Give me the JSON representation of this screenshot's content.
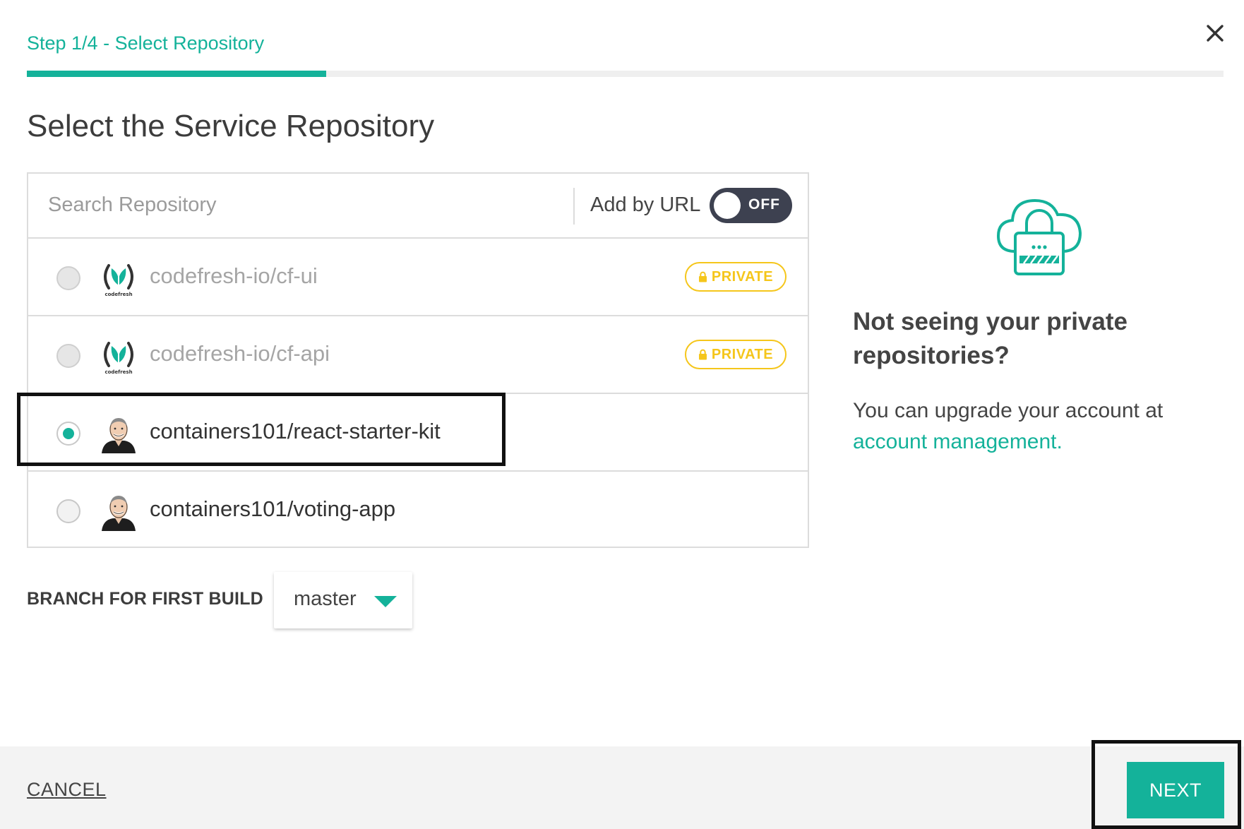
{
  "header": {
    "step_title": "Step 1/4 - Select Repository",
    "progress_fraction": 0.25,
    "close_icon": "close-icon"
  },
  "main": {
    "heading": "Select the Service Repository"
  },
  "search": {
    "placeholder": "Search Repository",
    "value": "",
    "add_by_url_label": "Add by URL",
    "toggle_state": "OFF"
  },
  "repositories": [
    {
      "name": "codefresh-io/cf-ui",
      "icon": "codefresh-logo-icon",
      "badge": "PRIVATE",
      "selected": false,
      "disabled": true
    },
    {
      "name": "codefresh-io/cf-api",
      "icon": "codefresh-logo-icon",
      "badge": "PRIVATE",
      "selected": false,
      "disabled": true
    },
    {
      "name": "containers101/react-starter-kit",
      "icon": "user-avatar-icon",
      "badge": "",
      "selected": true,
      "disabled": false
    },
    {
      "name": "containers101/voting-app",
      "icon": "user-avatar-icon",
      "badge": "",
      "selected": false,
      "disabled": false
    }
  ],
  "branch": {
    "label": "BRANCH FOR FIRST BUILD",
    "value": "master"
  },
  "info": {
    "icon": "cloud-lock-icon",
    "title": "Not seeing your private repositories?",
    "text": "You can upgrade your account at",
    "link": "account management."
  },
  "footer": {
    "cancel_label": "CANCEL",
    "next_label": "NEXT"
  },
  "colors": {
    "accent": "#14b29a",
    "private_badge": "#f5c61b",
    "toggle_bg": "#3d4150",
    "footer_bg": "#f3f3f3"
  }
}
